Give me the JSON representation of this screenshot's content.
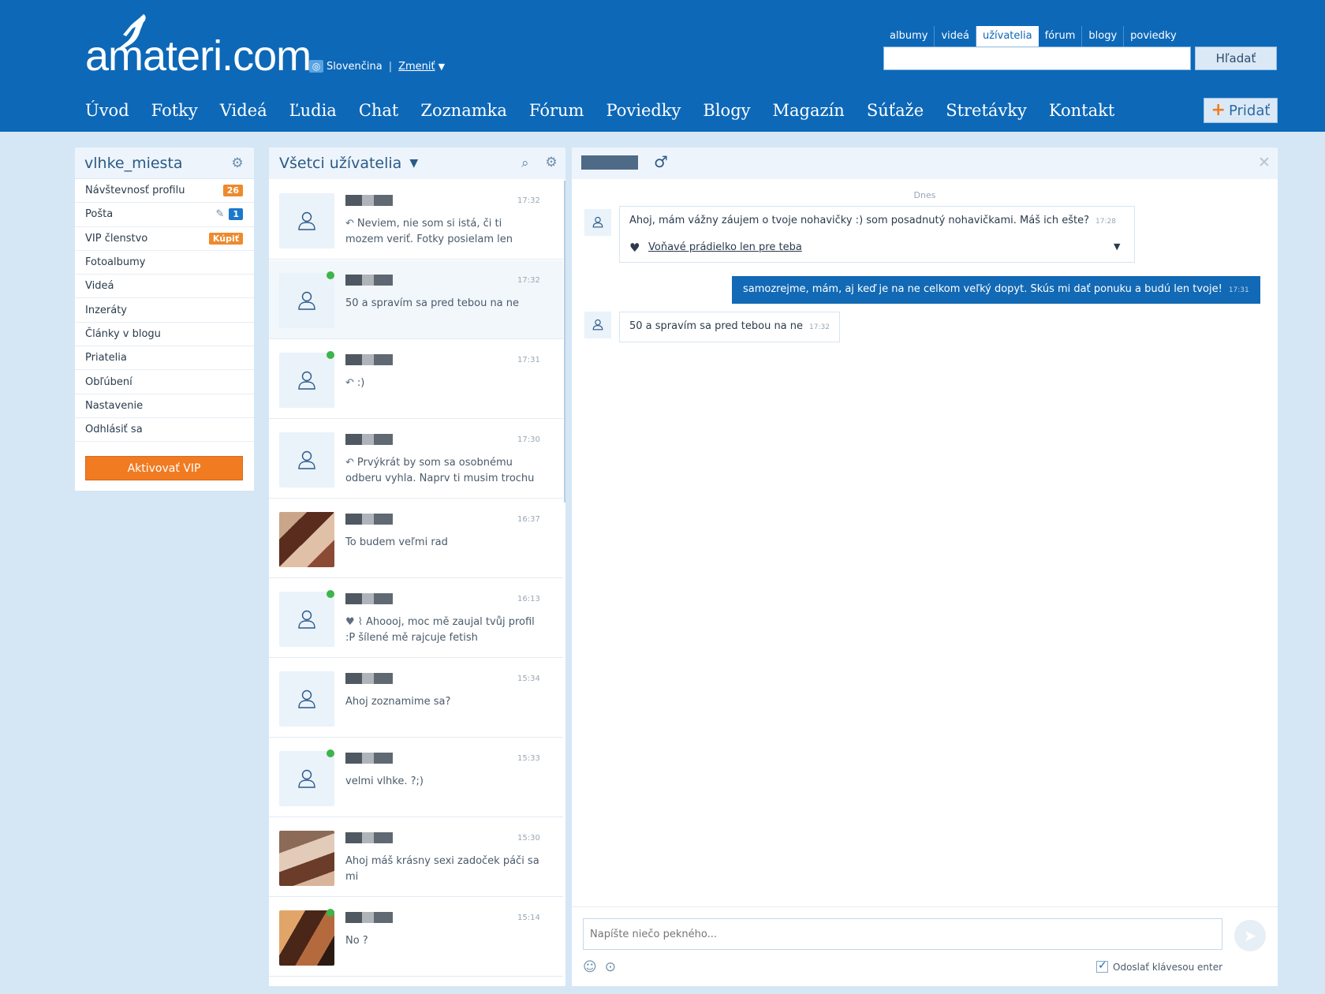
{
  "header": {
    "logo_text": "amateri.com",
    "language": "Slovenčina",
    "change_label": "Zmeniť",
    "search_tabs": [
      "albumy",
      "videá",
      "užívatelia",
      "fórum",
      "blogy",
      "poviedky"
    ],
    "active_search_tab": "užívatelia",
    "search_value": "",
    "search_button": "Hľadať",
    "nav": [
      "Úvod",
      "Fotky",
      "Videá",
      "Ľudia",
      "Chat",
      "Zoznamka",
      "Fórum",
      "Poviedky",
      "Blogy",
      "Magazín",
      "Súťaže",
      "Stretávky",
      "Kontakt"
    ],
    "add_button": "Pridať"
  },
  "sidebar": {
    "username": "vlhke_miesta",
    "items": [
      {
        "label": "Návštevnosť profilu",
        "badge": "26"
      },
      {
        "label": "Pošta",
        "badge": "1"
      },
      {
        "label": "VIP členstvo",
        "badge": "Kúpiť"
      },
      {
        "label": "Fotoalbumy"
      },
      {
        "label": "Videá"
      },
      {
        "label": "Inzeráty"
      },
      {
        "label": "Články v blogu"
      },
      {
        "label": "Priatelia"
      },
      {
        "label": "Obľúbení"
      },
      {
        "label": "Nastavenie"
      },
      {
        "label": "Odhlásiť sa"
      }
    ],
    "vip_button": "Aktivovať VIP"
  },
  "conversations": {
    "title": "Všetci užívatelia",
    "items": [
      {
        "time": "17:32",
        "message": "Neviem, nie som si istá, či ti mozem veriť. Fotky posielam len"
      },
      {
        "time": "17:32",
        "message": "50 a spravím sa pred tebou na ne"
      },
      {
        "time": "17:31",
        "message": ":)"
      },
      {
        "time": "17:30",
        "message": "Prvýkrát by som sa osobnému odberu vyhla. Naprv ti musim trochu"
      },
      {
        "time": "16:37",
        "message": "To budem veľmi rad"
      },
      {
        "time": "16:13",
        "message": "Ahoooj, moc mě zaujal tvůj profil :P šílené mě rajcuje fetish"
      },
      {
        "time": "15:34",
        "message": "Ahoj zoznamime sa?"
      },
      {
        "time": "15:33",
        "message": "velmi vlhke. ?;)"
      },
      {
        "time": "15:30",
        "message": "Ahoj máš krásny sexi zadoček páči sa mi"
      },
      {
        "time": "15:14",
        "message": "No ?"
      }
    ]
  },
  "chat": {
    "day_label": "Dnes",
    "messages": [
      {
        "dir": "in",
        "text": "Ahoj, mám vážny záujem o tvoje nohavičky :) som posadnutý nohavičkami. Máš ich ešte?",
        "time": "17:28",
        "attachment": "Voňavé prádielko len pre teba"
      },
      {
        "dir": "out",
        "text": "samozrejme, mám, aj keď je na ne celkom veľký dopyt. Skús mi dať ponuku a budú len tvoje!",
        "time": "17:31"
      },
      {
        "dir": "in",
        "text": "50 a spravím sa pred tebou na ne",
        "time": "17:32"
      }
    ],
    "input_placeholder": "Napíšte niečo pekného...",
    "enter_option": "Odoslať klávesou enter"
  },
  "colors": {
    "header_blue": "#0d68b8",
    "accent_orange": "#f07b21",
    "page_bg": "#d5e6f5"
  }
}
